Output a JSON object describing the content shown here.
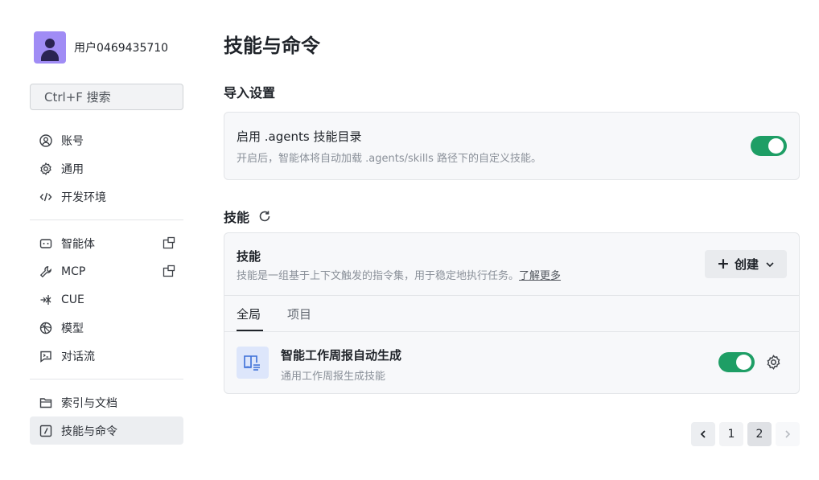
{
  "sidebar": {
    "username": "用户0469435710",
    "search_label": "Ctrl+F 搜索",
    "group1": [
      {
        "label": "账号",
        "icon": "user-circle-icon"
      },
      {
        "label": "通用",
        "icon": "gear-icon"
      },
      {
        "label": "开发环境",
        "icon": "code-icon"
      }
    ],
    "group2": [
      {
        "label": "智能体",
        "icon": "agent-icon"
      },
      {
        "label": "MCP",
        "icon": "wrench-icon"
      },
      {
        "label": "CUE",
        "icon": "cue-icon"
      },
      {
        "label": "模型",
        "icon": "model-icon"
      },
      {
        "label": "对话流",
        "icon": "chat-flow-icon"
      }
    ],
    "group3": [
      {
        "label": "索引与文档",
        "icon": "folder-icon"
      },
      {
        "label": "技能与命令",
        "icon": "slash-icon",
        "active": true
      }
    ]
  },
  "main": {
    "title": "技能与命令",
    "import_section": {
      "title": "导入设置",
      "card_title": "启用 .agents 技能目录",
      "card_desc": "开启后，智能体将自动加载 .agents/skills 路径下的自定义技能。",
      "enabled": true
    },
    "skills_section": {
      "title": "技能",
      "card_title": "技能",
      "card_desc": "技能是一组基于上下文触发的指令集，用于稳定地执行任务。",
      "learn_more": "了解更多",
      "create_label": "创建",
      "tabs": [
        "全局",
        "项目"
      ],
      "active_tab": 0,
      "items": [
        {
          "name": "智能工作周报自动生成",
          "desc": "通用工作周报生成技能",
          "enabled": true
        }
      ]
    },
    "pagination": {
      "pages": [
        "1",
        "2"
      ],
      "current": "2"
    }
  },
  "colors": {
    "accent_green": "#1e9e65",
    "avatar_purple": "#a08cf5"
  }
}
